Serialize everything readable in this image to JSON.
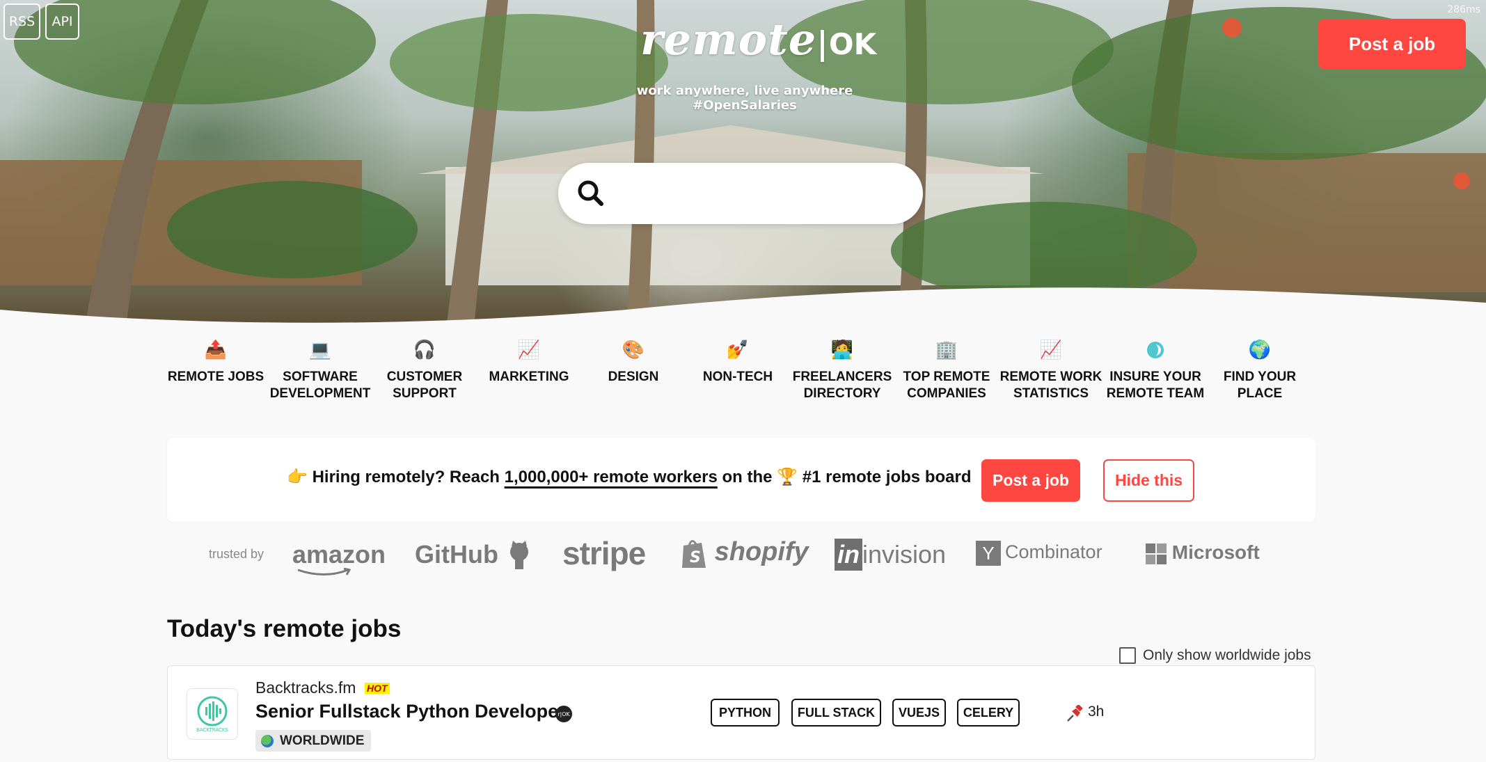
{
  "corner_links": {
    "rss": "RSS",
    "api": "API"
  },
  "logo": {
    "word": "remote",
    "ok": "OK",
    "tagline": "work anywhere, live anywhere #OpenSalaries"
  },
  "render_time": "286ms",
  "header": {
    "post_job": "Post a job"
  },
  "search": {
    "placeholder": ""
  },
  "categories": [
    {
      "label": "REMOTE JOBS",
      "icon": "outbox-tray-icon"
    },
    {
      "label": "SOFTWARE DEVELOPMENT",
      "icon": "laptop-icon"
    },
    {
      "label": "CUSTOMER SUPPORT",
      "icon": "headphones-icon"
    },
    {
      "label": "MARKETING",
      "icon": "chart-increasing-icon"
    },
    {
      "label": "DESIGN",
      "icon": "palette-icon"
    },
    {
      "label": "NON-TECH",
      "icon": "nail-icon"
    },
    {
      "label": "FREELANCERS DIRECTORY",
      "icon": "freelancer-icon"
    },
    {
      "label": "TOP REMOTE COMPANIES",
      "icon": "office-building-icon"
    },
    {
      "label": "REMOTE WORK STATISTICS",
      "icon": "chart-increasing-icon"
    },
    {
      "label": "INSURE YOUR REMOTE TEAM",
      "icon": "safetywing-icon"
    },
    {
      "label": "FIND YOUR PLACE",
      "icon": "globe-icon"
    }
  ],
  "banner": {
    "hiring": "Hiring remotely? Reach",
    "reach": "1,000,000+ remote workers",
    "on_the": "on the",
    "board": "#1 remote jobs board",
    "post_job": "Post a job",
    "hide": "Hide this"
  },
  "trusted_by": {
    "label": "trusted by",
    "brands": [
      "amazon",
      "GitHub",
      "stripe",
      "shopify",
      "invision",
      "Combinator",
      "Microsoft"
    ],
    "yc_letter": "Y"
  },
  "jobs": {
    "title": "Today's remote jobs",
    "worldwide_filter": "Only show worldwide jobs",
    "items": [
      {
        "company": "Backtracks.fm",
        "badge": "HOT",
        "title": "Senior Fullstack Python Developer",
        "location": "WORLDWIDE",
        "tags": [
          "PYTHON",
          "FULL STACK",
          "VUEJS",
          "CELERY"
        ],
        "age": "3h",
        "logo_text": "BACKTRACKS"
      }
    ]
  },
  "colors": {
    "accent": "#ff4742",
    "hot_bg": "#fff200",
    "logo_teal": "#3cc7a5"
  }
}
